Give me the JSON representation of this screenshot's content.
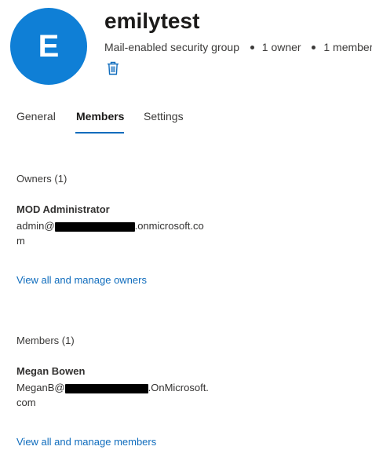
{
  "group": {
    "initial": "E",
    "name": "emilytest",
    "type": "Mail-enabled security group",
    "owners_count": "1 owner",
    "members_count": "1 member"
  },
  "tabs": [
    {
      "label": "General",
      "active": false
    },
    {
      "label": "Members",
      "active": true
    },
    {
      "label": "Settings",
      "active": false
    }
  ],
  "owners": {
    "heading": "Owners (1)",
    "name": "MOD Administrator",
    "email_prefix": "admin@",
    "email_suffix": ".onmicrosoft.com",
    "link": "View all and manage owners"
  },
  "members": {
    "heading": "Members (1)",
    "name": "Megan Bowen",
    "email_prefix": "MeganB@",
    "email_suffix": ".OnMicrosoft.com",
    "link": "View all and manage members"
  },
  "colors": {
    "accent": "#0f6cbd",
    "avatar": "#0f7fd6"
  },
  "icons": {
    "delete": "trash-icon"
  }
}
